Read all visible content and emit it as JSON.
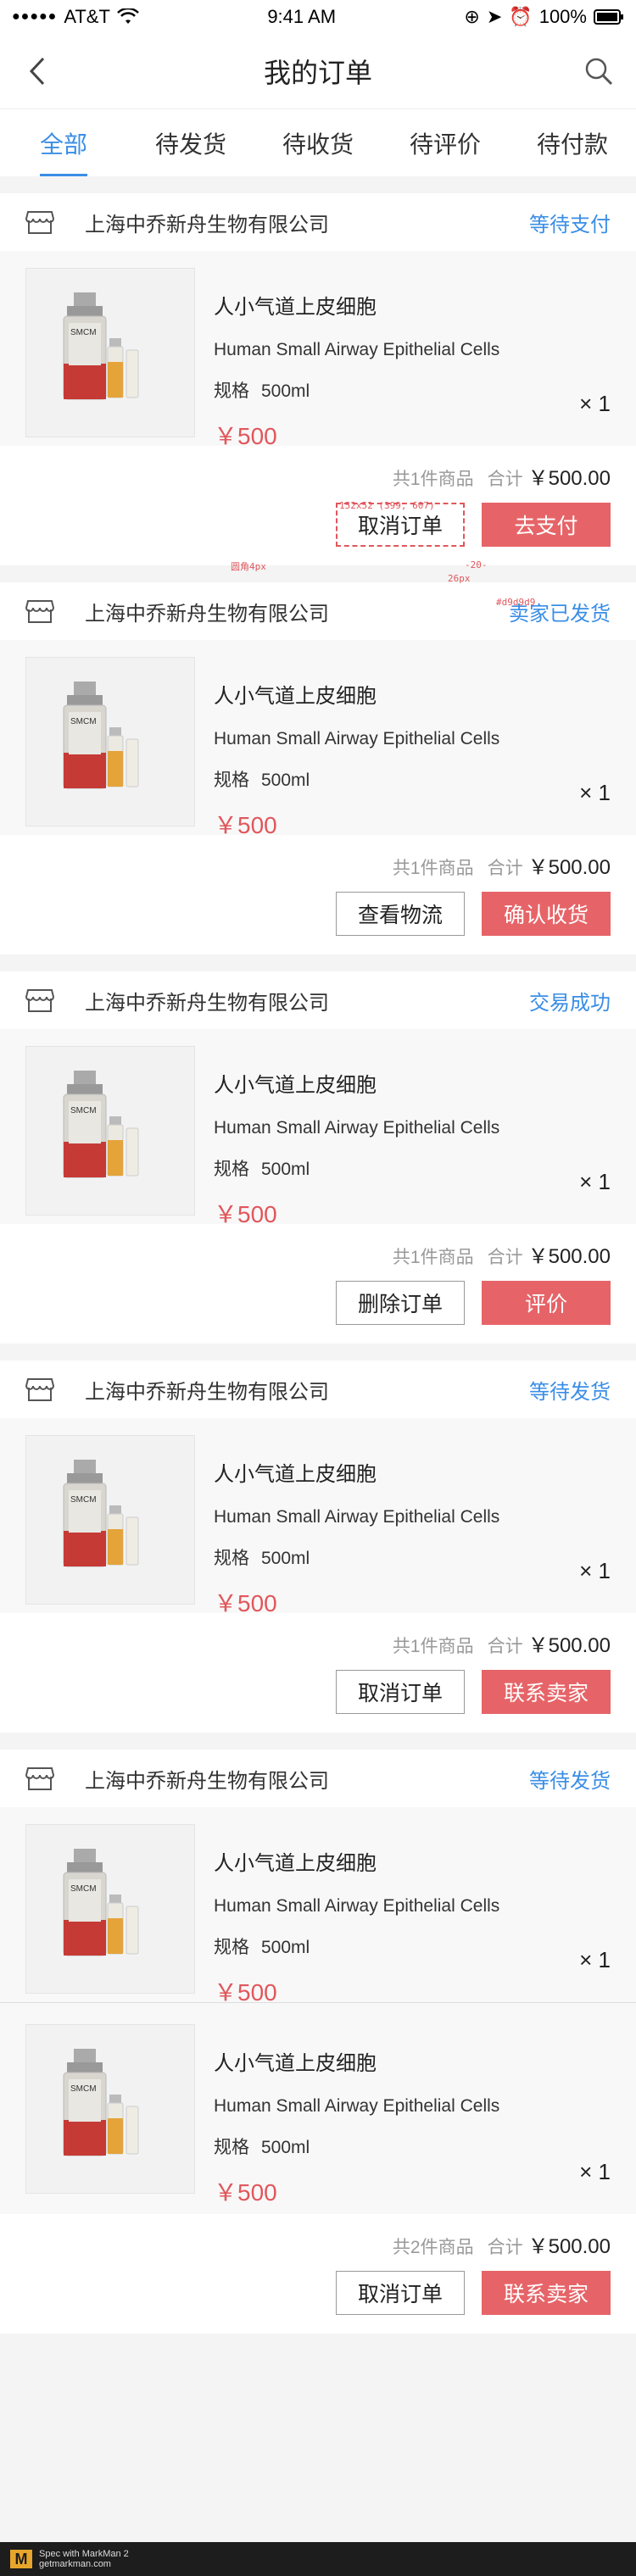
{
  "status_bar": {
    "carrier": "AT&T",
    "time": "9:41 AM",
    "battery": "100%"
  },
  "nav": {
    "title": "我的订单"
  },
  "tabs": [
    "全部",
    "待发货",
    "待收货",
    "待评价",
    "待付款"
  ],
  "colors": {
    "accent": "#3a8ee6",
    "price": "#e0575c",
    "primary_button": "#e66468"
  },
  "product": {
    "name": "人小气道上皮细胞",
    "name_en": "Human Small Airway Epithelial Cells",
    "spec_label": "规格",
    "spec_value": "500ml",
    "price": "￥500",
    "qty": "× 1",
    "thumb_label": "SMCM"
  },
  "summary_labels": {
    "total_label": "合计"
  },
  "orders": [
    {
      "shop": "上海中乔新舟生物有限公司",
      "status": "等待支付",
      "count_text": "共1件商品",
      "total": "￥500.00",
      "actions": [
        "取消订单",
        "去支付"
      ]
    },
    {
      "shop": "上海中乔新舟生物有限公司",
      "status": "卖家已发货",
      "count_text": "共1件商品",
      "total": "￥500.00",
      "actions": [
        "查看物流",
        "确认收货"
      ]
    },
    {
      "shop": "上海中乔新舟生物有限公司",
      "status": "交易成功",
      "count_text": "共1件商品",
      "total": "￥500.00",
      "actions": [
        "删除订单",
        "评价"
      ]
    },
    {
      "shop": "上海中乔新舟生物有限公司",
      "status": "等待发货",
      "count_text": "共1件商品",
      "total": "￥500.00",
      "actions": [
        "取消订单",
        "联系卖家"
      ]
    },
    {
      "shop": "上海中乔新舟生物有限公司",
      "status": "等待发货",
      "count_text": "共2件商品",
      "total": "￥500.00",
      "actions": [
        "取消订单",
        "联系卖家"
      ]
    }
  ],
  "annotations": {
    "size": "152x52 (399, 607)",
    "radius": "圆角4px",
    "gap": "-20-",
    "gap2": "26px",
    "color": "#d9d9d9"
  },
  "footer": {
    "brand": "Spec with MarkMan 2",
    "url": "getmarkman.com"
  }
}
